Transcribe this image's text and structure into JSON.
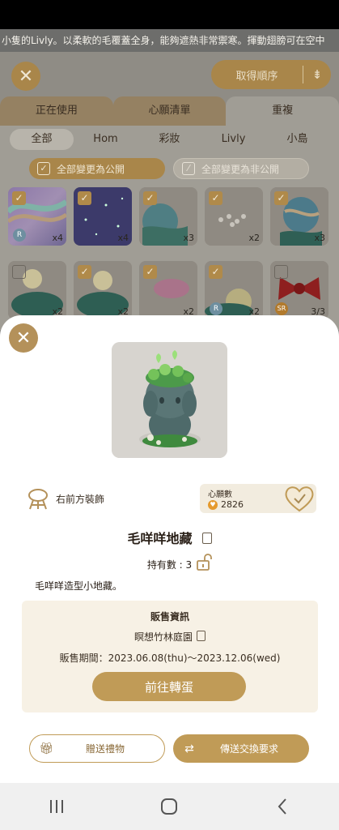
{
  "ticker": {
    "text": "小隻的Livly。以柔軟的毛覆蓋全身，能夠遮熱非常禦寒。揮動翅膀可在空中"
  },
  "header": {
    "sort_label": "取得順序"
  },
  "tabs": [
    "正在使用",
    "心願清單",
    "重複"
  ],
  "active_tab": 2,
  "subtabs": [
    "全部",
    "Hom",
    "彩妝",
    "Livly",
    "小島"
  ],
  "active_subtab": 0,
  "visibility": {
    "public_label": "全部變更為公開",
    "private_label": "全部變更為非公開"
  },
  "grid_items": [
    {
      "checked": true,
      "qty": "x4",
      "badge": "R"
    },
    {
      "checked": true,
      "qty": "x4",
      "badge": ""
    },
    {
      "checked": true,
      "qty": "x3",
      "badge": ""
    },
    {
      "checked": true,
      "qty": "x2",
      "badge": ""
    },
    {
      "checked": true,
      "qty": "x3",
      "badge": ""
    },
    {
      "checked": false,
      "qty": "x2",
      "badge": ""
    },
    {
      "checked": true,
      "qty": "x2",
      "badge": ""
    },
    {
      "checked": true,
      "qty": "x2",
      "badge": ""
    },
    {
      "checked": true,
      "qty": "x2",
      "badge": "R"
    },
    {
      "checked": false,
      "qty": "3/3",
      "badge": "SR"
    }
  ],
  "item": {
    "slot_label": "右前方裝飾",
    "wish_label": "心願數",
    "wish_count": "2826",
    "name": "毛咩咩地藏",
    "owned_text": "持有數 : 3",
    "description": "毛咩咩造型小地藏。"
  },
  "sale": {
    "heading": "販售資訊",
    "shop": "瞑想竹林庭園",
    "period": "販售期間：2023.06.08(thu)～2023.12.06(wed)",
    "go_label": "前往轉蛋"
  },
  "actions": {
    "gift_label": "贈送禮物",
    "trade_label": "傳送交換要求"
  },
  "colors": {
    "accent": "#c09b57",
    "sheet_bg": "#ffffff",
    "panel_bg": "#f7f1e5"
  }
}
